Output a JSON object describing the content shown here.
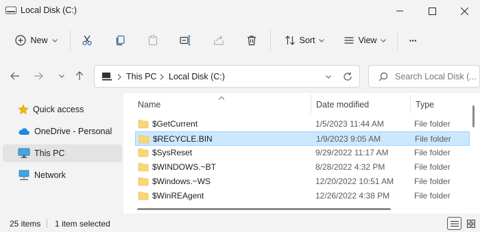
{
  "window": {
    "title": "Local Disk (C:)",
    "controls": {
      "minimize": "—",
      "maximize": "☐",
      "close": "✕"
    }
  },
  "toolbar": {
    "new_label": "New",
    "sort_label": "Sort",
    "view_label": "View",
    "more_label": "···",
    "icons": [
      "cut-icon",
      "copy-icon",
      "paste-icon",
      "rename-icon",
      "share-icon",
      "delete-icon"
    ]
  },
  "address": {
    "breadcrumbs": [
      "This PC",
      "Local Disk (C:)"
    ],
    "search_placeholder": "Search Local Disk (..."
  },
  "nav": {
    "items": [
      {
        "label": "Quick access",
        "icon": "star-icon"
      },
      {
        "label": "OneDrive - Personal",
        "icon": "cloud-icon"
      },
      {
        "label": "This PC",
        "icon": "pc-icon",
        "selected": true
      },
      {
        "label": "Network",
        "icon": "network-icon"
      }
    ]
  },
  "list": {
    "columns": [
      "Name",
      "Date modified",
      "Type"
    ],
    "rows": [
      {
        "name": "$GetCurrent",
        "date": "1/5/2023 11:44 AM",
        "type": "File folder"
      },
      {
        "name": "$RECYCLE.BIN",
        "date": "1/9/2023 9:05 AM",
        "type": "File folder",
        "selected": true
      },
      {
        "name": "$SysReset",
        "date": "9/29/2022 11:17 AM",
        "type": "File folder"
      },
      {
        "name": "$WINDOWS.~BT",
        "date": "8/28/2022 4:32 PM",
        "type": "File folder"
      },
      {
        "name": "$Windows.~WS",
        "date": "12/20/2022 10:51 AM",
        "type": "File folder"
      },
      {
        "name": "$WinREAgent",
        "date": "12/26/2022 4:38 PM",
        "type": "File folder"
      }
    ]
  },
  "status": {
    "count": "25 items",
    "selection": "1 item selected"
  },
  "colors": {
    "accent": "#0067c0",
    "selection_bg": "#cce8ff",
    "folder": "#f8d775"
  }
}
